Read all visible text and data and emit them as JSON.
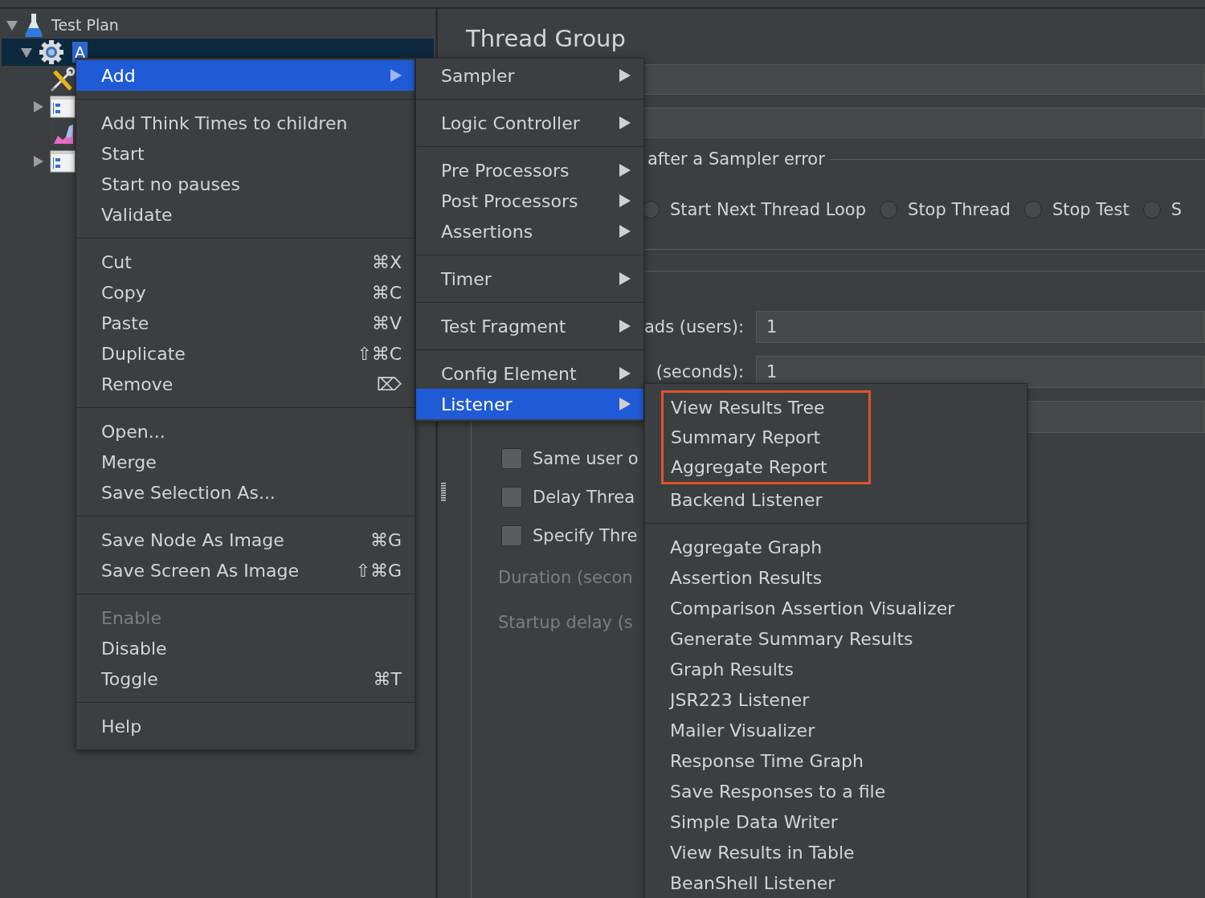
{
  "tree": [
    {
      "label": "Test Plan",
      "kind": "plan",
      "expanded": true,
      "selected": false,
      "children": [
        {
          "label": "A",
          "kind": "thread-group",
          "expanded": true,
          "selected": true,
          "children": [
            {
              "kind": "config",
              "selected": false
            },
            {
              "kind": "controller",
              "expanded": false,
              "selected": false
            },
            {
              "kind": "listener",
              "selected": false
            },
            {
              "kind": "controller",
              "expanded": false,
              "selected": false
            }
          ]
        }
      ]
    }
  ],
  "panel": {
    "title": "Thread Group",
    "error_action": {
      "legend": "after a Sampler error",
      "options": [
        {
          "label": "Start Next Thread Loop",
          "selected": false
        },
        {
          "label": "Stop Thread",
          "selected": false
        },
        {
          "label": "Stop Test",
          "selected": false
        },
        {
          "label": "S",
          "selected": false
        }
      ]
    },
    "properties": [
      {
        "label": "ads (users):",
        "value": "1"
      },
      {
        "label": "(seconds):",
        "value": "1"
      },
      {
        "kind": "covered"
      }
    ],
    "checkboxes": [
      {
        "label": "Same user o",
        "checked": false
      },
      {
        "label": "Delay Threa",
        "checked": false
      },
      {
        "label": "Specify Thre",
        "checked": false
      }
    ],
    "disabled_fields": [
      "Duration (secon",
      "Startup delay (s"
    ]
  },
  "context_menu": [
    [
      {
        "label": "Add",
        "submenu": true,
        "selected": true,
        "disabled": false
      }
    ],
    [
      {
        "label": "Add Think Times to children",
        "submenu": false,
        "selected": false,
        "disabled": false
      },
      {
        "label": "Start",
        "submenu": false,
        "selected": false,
        "disabled": false
      },
      {
        "label": "Start no pauses",
        "submenu": false,
        "selected": false,
        "disabled": false
      },
      {
        "label": "Validate",
        "submenu": false,
        "selected": false,
        "disabled": false
      }
    ],
    [
      {
        "label": "Cut",
        "shortcut": "⌘X",
        "submenu": false,
        "selected": false,
        "disabled": false
      },
      {
        "label": "Copy",
        "shortcut": "⌘C",
        "submenu": false,
        "selected": false,
        "disabled": false
      },
      {
        "label": "Paste",
        "shortcut": "⌘V",
        "submenu": false,
        "selected": false,
        "disabled": false
      },
      {
        "label": "Duplicate",
        "shortcut": "⇧⌘C",
        "submenu": false,
        "selected": false,
        "disabled": false
      },
      {
        "label": "Remove",
        "shortcut": "⌦",
        "submenu": false,
        "selected": false,
        "disabled": false
      }
    ],
    [
      {
        "label": "Open...",
        "submenu": false,
        "selected": false,
        "disabled": false
      },
      {
        "label": "Merge",
        "submenu": false,
        "selected": false,
        "disabled": false
      },
      {
        "label": "Save Selection As...",
        "submenu": false,
        "selected": false,
        "disabled": false
      }
    ],
    [
      {
        "label": "Save Node As Image",
        "shortcut": "⌘G",
        "submenu": false,
        "selected": false,
        "disabled": false
      },
      {
        "label": "Save Screen As Image",
        "shortcut": "⇧⌘G",
        "submenu": false,
        "selected": false,
        "disabled": false
      }
    ],
    [
      {
        "label": "Enable",
        "submenu": false,
        "selected": false,
        "disabled": true
      },
      {
        "label": "Disable",
        "submenu": false,
        "selected": false,
        "disabled": false
      },
      {
        "label": "Toggle",
        "shortcut": "⌘T",
        "submenu": false,
        "selected": false,
        "disabled": false
      }
    ],
    [
      {
        "label": "Help",
        "submenu": false,
        "selected": false,
        "disabled": false
      }
    ]
  ],
  "add_submenu": [
    [
      {
        "label": "Sampler",
        "submenu": true,
        "selected": false
      }
    ],
    [
      {
        "label": "Logic Controller",
        "submenu": true,
        "selected": false
      }
    ],
    [
      {
        "label": "Pre Processors",
        "submenu": true,
        "selected": false
      },
      {
        "label": "Post Processors",
        "submenu": true,
        "selected": false
      },
      {
        "label": "Assertions",
        "submenu": true,
        "selected": false
      }
    ],
    [
      {
        "label": "Timer",
        "submenu": true,
        "selected": false
      }
    ],
    [
      {
        "label": "Test Fragment",
        "submenu": true,
        "selected": false
      }
    ],
    [
      {
        "label": "Config Element",
        "submenu": true,
        "selected": false
      },
      {
        "label": "Listener",
        "submenu": true,
        "selected": true
      }
    ]
  ],
  "listener_submenu": [
    [
      {
        "outlined": true,
        "items": [
          "View Results Tree",
          "Summary Report",
          "Aggregate Report"
        ]
      },
      {
        "outlined": false,
        "items": [
          "Backend Listener"
        ]
      }
    ],
    [
      {
        "outlined": false,
        "items": [
          "Aggregate Graph",
          "Assertion Results",
          "Comparison Assertion Visualizer",
          "Generate Summary Results",
          "Graph Results",
          "JSR223 Listener",
          "Mailer Visualizer",
          "Response Time Graph",
          "Save Responses to a file",
          "Simple Data Writer",
          "View Results in Table",
          "BeanShell Listener"
        ]
      }
    ]
  ]
}
